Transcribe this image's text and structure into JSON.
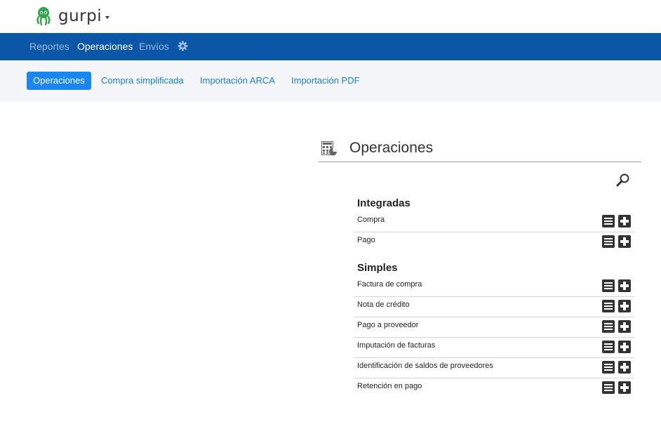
{
  "app": {
    "brand": "gurpi"
  },
  "nav": {
    "items": [
      {
        "label": "Reportes"
      },
      {
        "label": "Operaciones"
      },
      {
        "label": "Envíos"
      }
    ]
  },
  "subnav": {
    "tabs": [
      {
        "label": "Operaciones"
      },
      {
        "label": "Compra simplificada"
      },
      {
        "label": "Importación ARCA"
      },
      {
        "label": "Importación PDF"
      }
    ]
  },
  "panel": {
    "title": "Operaciones",
    "sections": [
      {
        "heading": "Integradas",
        "items": [
          {
            "label": "Compra"
          },
          {
            "label": "Pago"
          }
        ]
      },
      {
        "heading": "Simples",
        "items": [
          {
            "label": "Factura de compra"
          },
          {
            "label": "Nota de crédito"
          },
          {
            "label": "Pago a proveedor"
          },
          {
            "label": "Imputación de facturas"
          },
          {
            "label": "Identificación de saldos de proveedores"
          },
          {
            "label": "Retención en pago"
          }
        ]
      }
    ]
  },
  "colors": {
    "navbar": "#0b56a6",
    "accent": "#1a86f0",
    "link": "#1a7fd4",
    "logo": "#2aa84a"
  },
  "icons": {
    "logo": "octopus-logo-icon",
    "settings": "gear-icon",
    "panel": "calculator-icon",
    "search": "search-icon",
    "list": "list-icon",
    "add": "plus-icon"
  }
}
